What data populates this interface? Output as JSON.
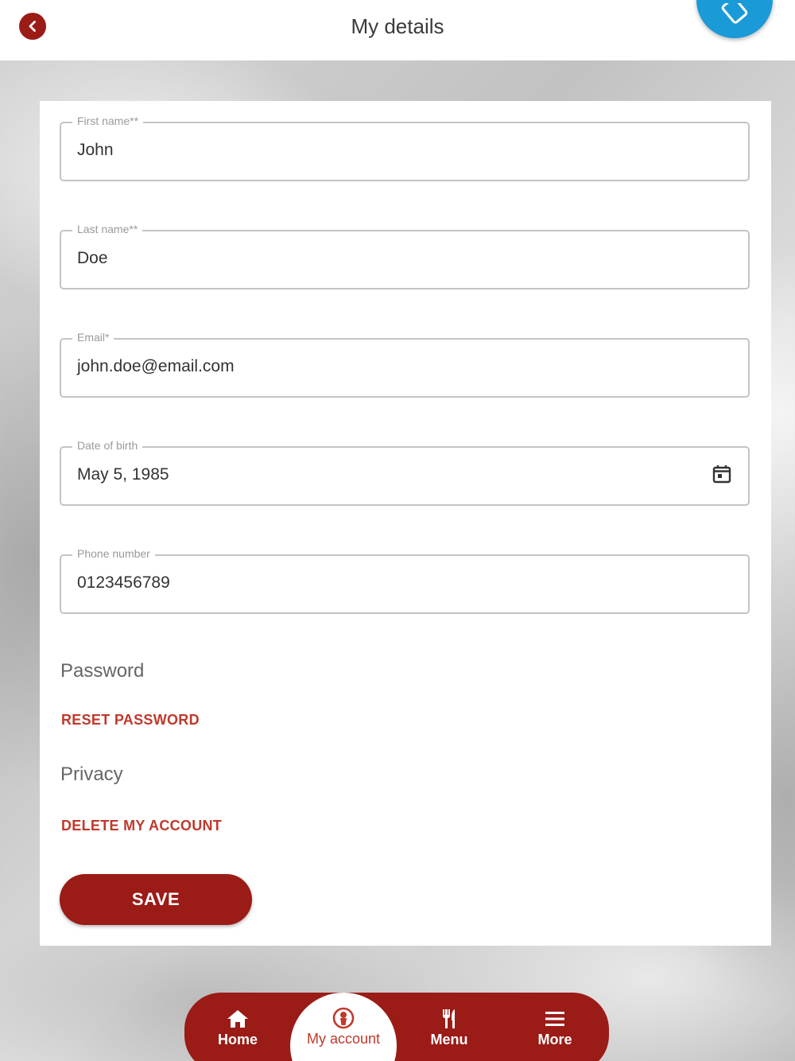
{
  "header": {
    "title": "My details",
    "back_icon": "chevron-left-icon",
    "rotate_icon": "screen-rotation-icon"
  },
  "form": {
    "fields": [
      {
        "label": "First name**",
        "value": "John"
      },
      {
        "label": "Last name**",
        "value": "Doe"
      },
      {
        "label": "Email*",
        "value": "john.doe@email.com"
      },
      {
        "label": "Date of birth",
        "value": "May 5, 1985",
        "icon": "calendar-icon"
      },
      {
        "label": "Phone number",
        "value": "0123456789"
      }
    ],
    "password_title": "Password",
    "reset_password_label": "RESET PASSWORD",
    "privacy_title": "Privacy",
    "delete_account_label": "DELETE MY ACCOUNT",
    "save_label": "SAVE"
  },
  "nav": {
    "items": [
      {
        "label": "Home",
        "icon": "home-icon"
      },
      {
        "label": "My account",
        "icon": "account-icon",
        "active": true
      },
      {
        "label": "Menu",
        "icon": "cutlery-icon"
      },
      {
        "label": "More",
        "icon": "hamburger-menu-icon"
      }
    ]
  },
  "colors": {
    "brand": "#9b1b16",
    "link": "#c0392b",
    "rotate_button": "#1a9bd7"
  }
}
